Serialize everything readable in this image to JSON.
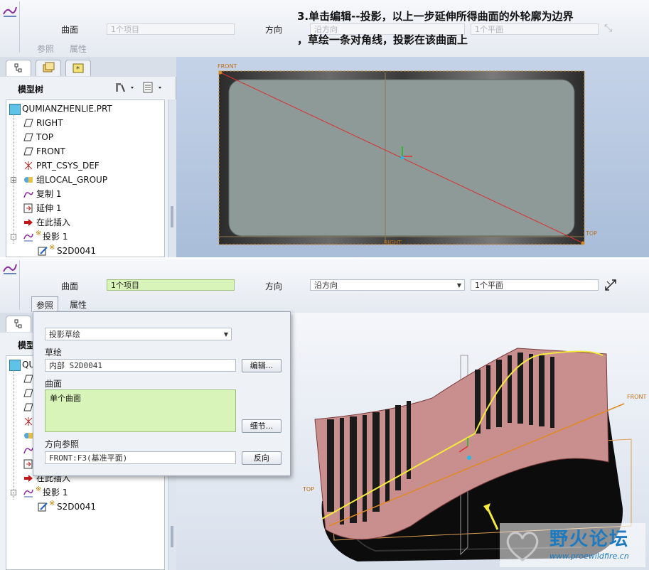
{
  "instruction": {
    "line1": "3.单击编辑--投影，以上一步延伸所得曲面的外轮廓为边界",
    "line2": "，草绘一条对角线，投影在该曲面上"
  },
  "top_dash": {
    "surface_label": "曲面",
    "surface_value": "1个项目",
    "direction_label": "方向",
    "direction_value": "沿方向",
    "plane_value": "1个平面",
    "tab_refs": "参照",
    "tab_props": "属性"
  },
  "bottom_dash": {
    "surface_label": "曲面",
    "surface_value": "1个项目",
    "direction_label": "方向",
    "direction_value": "沿方向",
    "plane_value": "1个平面",
    "tab_refs": "参照",
    "tab_props": "属性"
  },
  "model_tree": {
    "title": "模型树",
    "title_partial": "模型",
    "items": [
      {
        "label": "QUMIANZHENLIE.PRT",
        "icon": "part-icon"
      },
      {
        "label": "RIGHT",
        "icon": "datum-plane-icon"
      },
      {
        "label": "TOP",
        "icon": "datum-plane-icon"
      },
      {
        "label": "FRONT",
        "icon": "datum-plane-icon"
      },
      {
        "label": "PRT_CSYS_DEF",
        "icon": "csys-icon"
      },
      {
        "label": "组LOCAL_GROUP",
        "icon": "group-icon"
      },
      {
        "label": "复制 1",
        "icon": "copy-icon"
      },
      {
        "label": "延伸 1",
        "icon": "extend-icon"
      },
      {
        "label": "在此插入",
        "icon": "insert-arrow-icon"
      },
      {
        "label": "投影 1",
        "icon": "project-icon"
      },
      {
        "label": "S2D0041",
        "icon": "sketch-icon"
      }
    ],
    "bottom_items": [
      {
        "label": "QU"
      },
      {
        "label": "在此插入"
      },
      {
        "label": "投影 1"
      },
      {
        "label": "S2D0041"
      }
    ]
  },
  "viewport_top": {
    "label_front": "FRONT",
    "label_top": "TOP",
    "label_right": "RIGHT"
  },
  "viewport_bottom": {
    "label_front": "FRONT",
    "label_top": "TOP"
  },
  "refs_popup": {
    "type_select": "投影草绘",
    "sketch_label": "草绘",
    "sketch_value": "内部 S2D0041",
    "edit_button": "编辑...",
    "surfaces_label": "曲面",
    "surfaces_value": "单个曲面",
    "details_button": "细节...",
    "dir_ref_label": "方向参照",
    "dir_ref_value": "FRONT:F3(基准平面)",
    "flip_button": "反向"
  },
  "watermark": {
    "name": "野火论坛",
    "url": "www.proewildfire.cn"
  },
  "colors": {
    "accent_green": "#d9f4b8",
    "viewport_blue": "#b4c6df",
    "surface_pink": "#c98f8f",
    "curve_yellow": "#f5ea3a"
  }
}
